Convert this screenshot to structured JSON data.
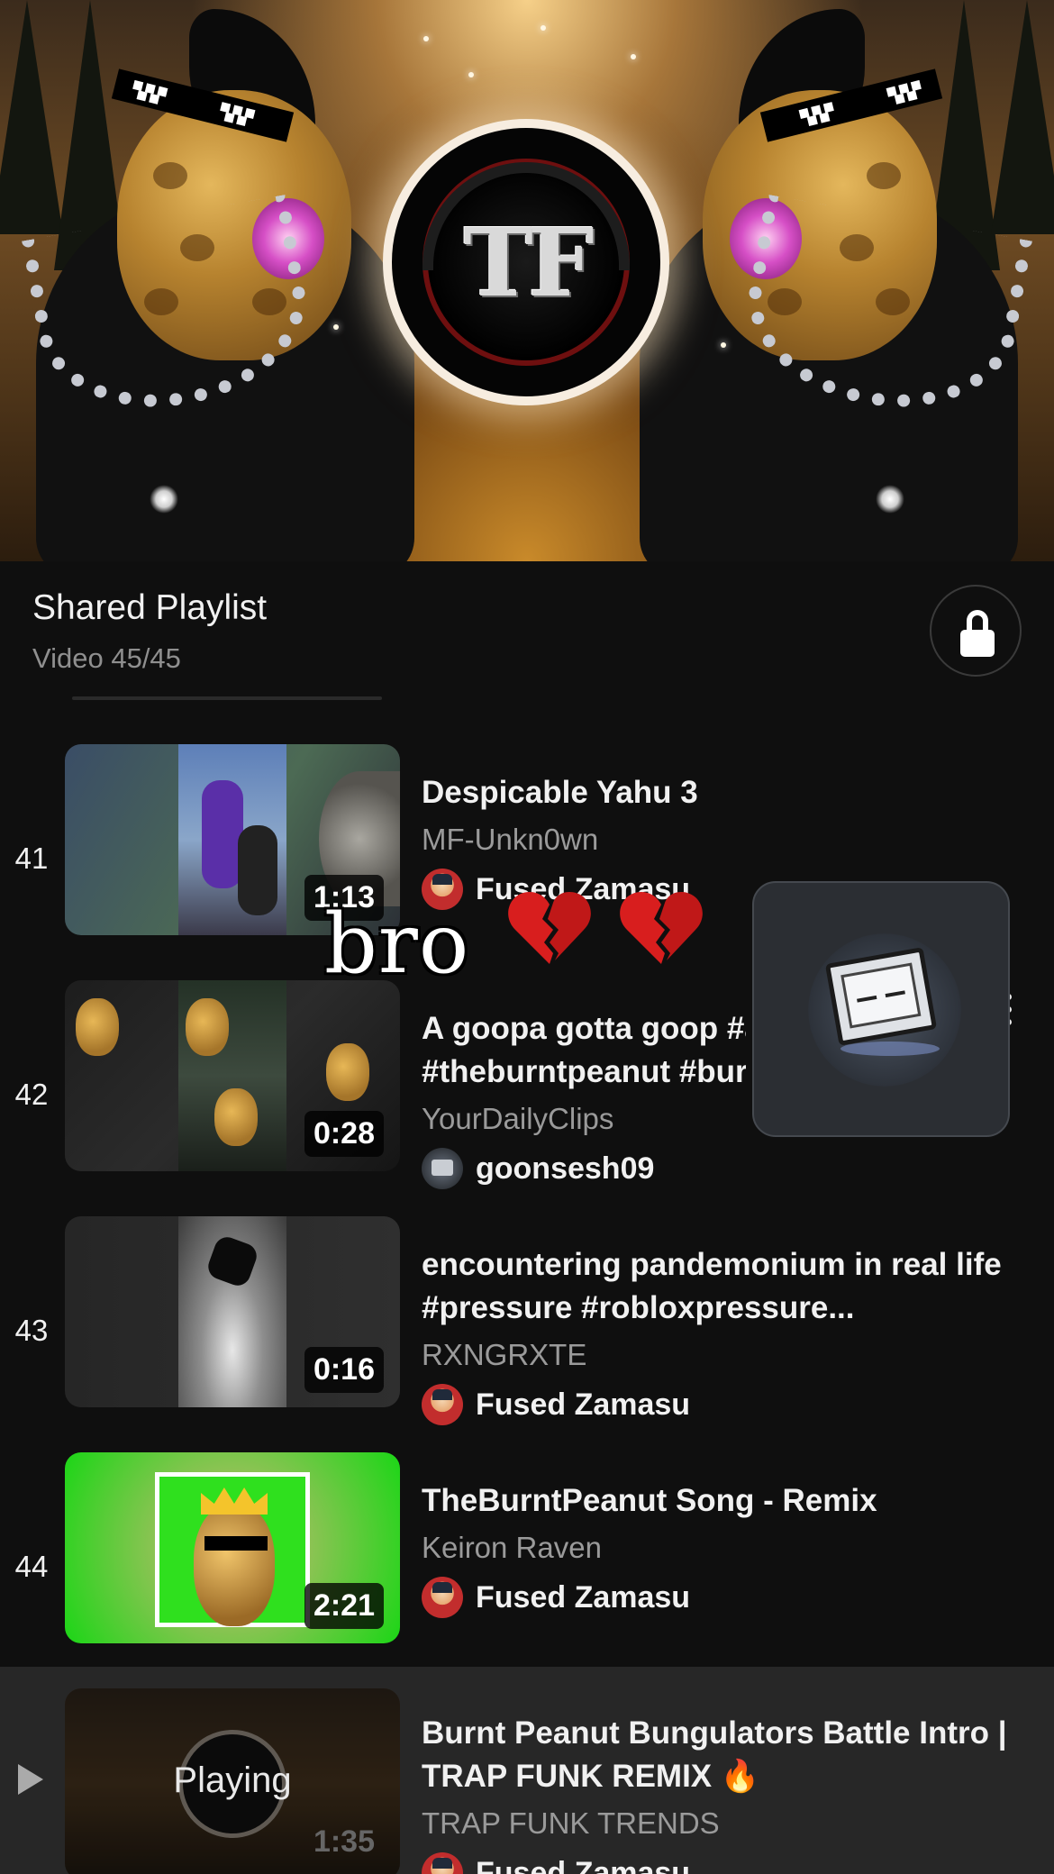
{
  "player": {
    "logo_text": "TF"
  },
  "playlist": {
    "title": "Shared Playlist",
    "position": "Video 45/45",
    "lock_icon": "lock-icon"
  },
  "rows": [
    {
      "index": "41",
      "title": "Despicable Yahu 3",
      "channel": "MF-Unkn0wn",
      "duration": "1:13",
      "added_by": "Fused Zamasu",
      "added_by_partial": "Fused Zamasu"
    },
    {
      "index": "42",
      "title_line1": "A goopa gotta goop #a",
      "title_line2": "#theburntpeanut #burn",
      "channel": "YourDailyClips",
      "duration": "0:28",
      "added_by": "goonsesh09"
    },
    {
      "index": "43",
      "title_line1": "encountering pandemonium in real life",
      "title_line2": "#pressure #robloxpressure...",
      "channel": "RXNGRXTE",
      "duration": "0:16",
      "added_by": "Fused Zamasu"
    },
    {
      "index": "44",
      "title": "TheBurntPeanut Song - Remix",
      "channel": "Keiron Raven",
      "duration": "2:21",
      "added_by": "Fused Zamasu"
    },
    {
      "title_line1": "Burnt Peanut Bungulators Battle Intro |",
      "title_line2": "TRAP FUNK REMIX 🔥",
      "channel": "TRAP FUNK TRENDS",
      "duration": "1:35",
      "status": "Playing",
      "added_by": "Fused Zamasu"
    }
  ],
  "overlay": {
    "sticker_text": "bro",
    "heart_icon": "broken-heart-icon",
    "pip_icon": "computer-monitor-icon"
  },
  "colors": {
    "background": "#0f0f0f",
    "current_row": "#272727",
    "secondary_text": "#9a9a9a",
    "heart": "#d81e1e"
  }
}
